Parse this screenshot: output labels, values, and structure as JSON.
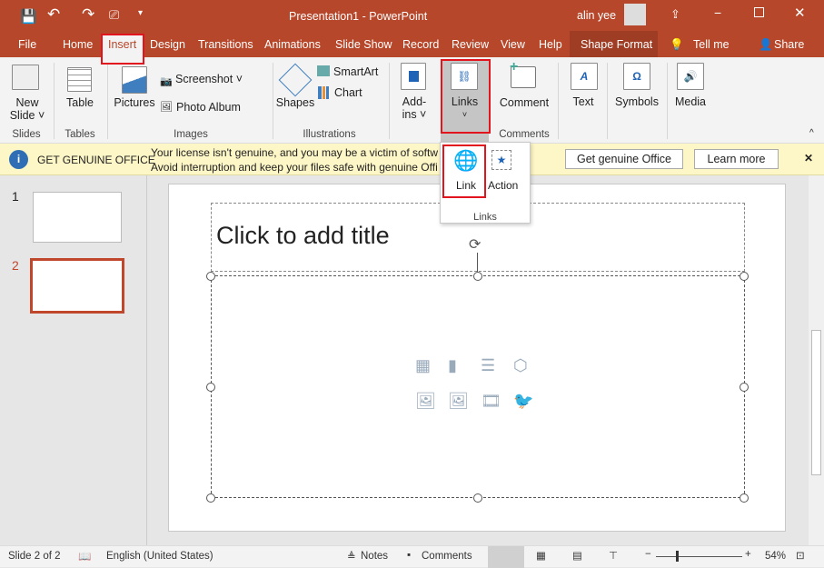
{
  "title": "Presentation1  -  PowerPoint",
  "user": "alin yee",
  "colors": {
    "accent": "#b7472a",
    "highlight": "#e2141d",
    "infobar": "#fdf6c6"
  },
  "tabs": [
    "File",
    "Home",
    "Insert",
    "Design",
    "Transitions",
    "Animations",
    "Slide Show",
    "Record",
    "Review",
    "View",
    "Help",
    "Shape Format"
  ],
  "tell_me": "Tell me",
  "share": "Share",
  "ribbon": {
    "new_slide": [
      "New",
      "Slide ˅"
    ],
    "table": "Table",
    "pictures": "Pictures",
    "screenshot": "Screenshot ˅",
    "photo_album": "Photo Album",
    "shapes": "Shapes",
    "smartart": "SmartArt",
    "chart": "Chart",
    "addins": [
      "Add-",
      "ins ˅"
    ],
    "links": "Links",
    "comment": "Comment",
    "text": "Text",
    "symbols": "Symbols",
    "media": "Media",
    "groups": {
      "slides": "Slides",
      "tables": "Tables",
      "images": "Images",
      "illustrations": "Illustrations",
      "comments": "Comments"
    }
  },
  "links_dropdown": {
    "link": "Link",
    "action": "Action",
    "group": "Links"
  },
  "infobar": {
    "title": "GET GENUINE OFFICE",
    "line1": "Your license isn't genuine, and you may be a victim of softw",
    "line2": "Avoid interruption and keep your files safe with genuine Offi",
    "get_button": "Get genuine Office",
    "learn_button": "Learn more"
  },
  "thumbnails": [
    "1",
    "2"
  ],
  "slide": {
    "title_placeholder": "Click to add title"
  },
  "status": {
    "slide": "Slide 2 of 2",
    "language": "English (United States)",
    "notes": "Notes",
    "comments": "Comments",
    "zoom": "54%",
    "zoom_level": 54
  }
}
